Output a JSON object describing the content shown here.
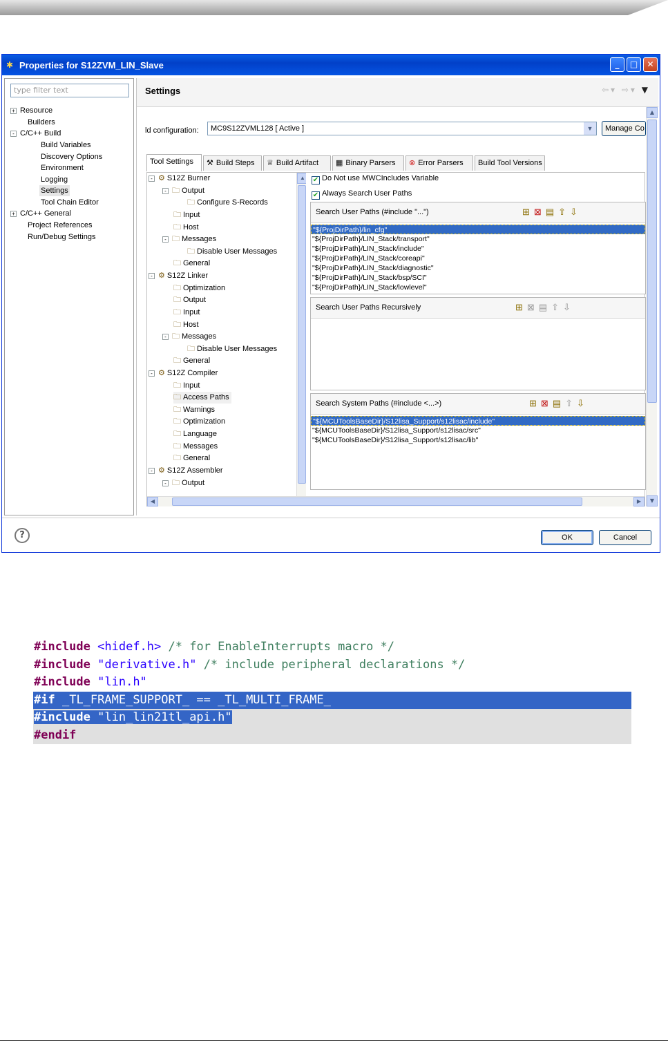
{
  "dialog": {
    "title": "Properties for S12ZVM_LIN_Slave",
    "minimize": "_",
    "maximize": "□",
    "close": "✕"
  },
  "filter_placeholder": "type filter text",
  "nav": [
    {
      "label": "Resource",
      "expander": "+"
    },
    {
      "label": "Builders"
    },
    {
      "label": "C/C++ Build",
      "expander": "-"
    },
    {
      "label": "Build Variables"
    },
    {
      "label": "Discovery Options"
    },
    {
      "label": "Environment"
    },
    {
      "label": "Logging"
    },
    {
      "label": "Settings",
      "selected": true
    },
    {
      "label": "Tool Chain Editor"
    },
    {
      "label": "C/C++ General",
      "expander": "+"
    },
    {
      "label": "Project References"
    },
    {
      "label": "Run/Debug Settings"
    }
  ],
  "settings_title": "Settings",
  "config": {
    "label": "ld configuration:",
    "value": "MC9S12ZVML128  [ Active ]",
    "manage": "Manage Co"
  },
  "tabs": [
    {
      "label": "Tool Settings",
      "active": true
    },
    {
      "label": "Build Steps"
    },
    {
      "label": "Build Artifact"
    },
    {
      "label": "Binary Parsers"
    },
    {
      "label": "Error Parsers"
    },
    {
      "label": "Build Tool Versions"
    }
  ],
  "tree": [
    {
      "label": "S12Z Burner"
    },
    {
      "label": "Output"
    },
    {
      "label": "Configure S-Records"
    },
    {
      "label": "Input"
    },
    {
      "label": "Host"
    },
    {
      "label": "Messages"
    },
    {
      "label": "Disable User Messages"
    },
    {
      "label": "General"
    },
    {
      "label": "S12Z Linker"
    },
    {
      "label": "Optimization"
    },
    {
      "label": "Output"
    },
    {
      "label": "Input"
    },
    {
      "label": "Host"
    },
    {
      "label": "Messages"
    },
    {
      "label": "Disable User Messages"
    },
    {
      "label": "General"
    },
    {
      "label": "S12Z Compiler"
    },
    {
      "label": "Input"
    },
    {
      "label": "Access Paths",
      "highlighted": true
    },
    {
      "label": "Warnings"
    },
    {
      "label": "Optimization"
    },
    {
      "label": "Language"
    },
    {
      "label": "Messages"
    },
    {
      "label": "General"
    },
    {
      "label": "S12Z Assembler"
    },
    {
      "label": "Output"
    }
  ],
  "checks": {
    "no_mwc": "Do Not use MWCIncludes Variable",
    "always_search": "Always Search User Paths"
  },
  "user_paths": {
    "title": "Search User Paths (#include \"...\")",
    "items": [
      "\"${ProjDirPath}/lin_cfg\"",
      "\"${ProjDirPath}/LIN_Stack/transport\"",
      "\"${ProjDirPath}/LIN_Stack/include\"",
      "\"${ProjDirPath}/LIN_Stack/coreapi\"",
      "\"${ProjDirPath}/LIN_Stack/diagnostic\"",
      "\"${ProjDirPath}/LIN_Stack/bsp/SCI\"",
      "\"${ProjDirPath}/LIN_Stack/lowlevel\""
    ]
  },
  "recursive_paths": {
    "title": "Search User Paths Recursively"
  },
  "system_paths": {
    "title": "Search System Paths (#include <...>)",
    "items": [
      "\"${MCUToolsBaseDir}/S12lisa_Support/s12lisac/include\"",
      "\"${MCUToolsBaseDir}/S12lisa_Support/s12lisac/src\"",
      "\"${MCUToolsBaseDir}/S12lisa_Support/s12lisac/lib\""
    ]
  },
  "buttons": {
    "help": "?",
    "ok": "OK",
    "cancel": "Cancel"
  },
  "code": {
    "l1_kw": "#include",
    "l1_hdr": "<hidef.h>",
    "l1_cm": "/* for EnableInterrupts macro */",
    "l2_kw": "#include",
    "l2_str": "\"derivative.h\"",
    "l2_cm": "/* include peripheral declarations */",
    "l3_kw": "#include",
    "l3_str": "\"lin.h\"",
    "l4_kw": "#if",
    "l4_rest": "_TL_FRAME_SUPPORT_ == _TL_MULTI_FRAME_",
    "l5_kw": "#include",
    "l5_str": "\"lin_lin21tl_api.h\"",
    "l6_kw": "#endif"
  }
}
